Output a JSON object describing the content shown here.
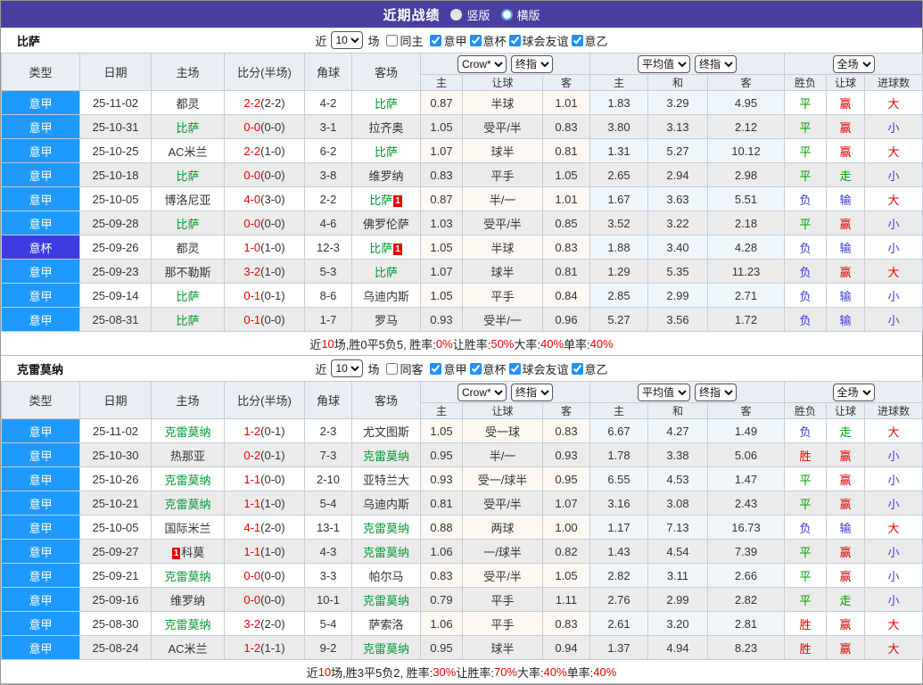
{
  "colors": {
    "title_bar_bg": "#4a3f9e",
    "league_serie_a_bg": "#1e9aff",
    "league_cup_bg": "#3c3ce0",
    "self_team_green": "#009933",
    "result_red": "#e60000",
    "result_green": "#009900",
    "result_blue": "#3a3ad6",
    "checkbox_blue": "#1e90ff"
  },
  "title_bar": {
    "title": "近期战绩",
    "vertical_label": "竖版",
    "horizontal_label": "横版"
  },
  "filter": {
    "near_label": "近",
    "count": "10",
    "games_label": "场",
    "leagues": [
      "意甲",
      "意杯",
      "球会友谊",
      "意乙"
    ]
  },
  "header": {
    "type": "类型",
    "date": "日期",
    "home": "主场",
    "score": "比分(半场)",
    "corner": "角球",
    "away": "客场",
    "crow_select": "Crow*",
    "final_select_1": "终指",
    "avg_select": "平均值",
    "final_select_2": "终指",
    "full_select": "全场",
    "sub": [
      "主",
      "让球",
      "客",
      "主",
      "和",
      "客",
      "胜负",
      "让球",
      "进球数"
    ]
  },
  "sections": [
    {
      "team": "比萨",
      "same_label": "同主",
      "rows": [
        {
          "type": "意甲",
          "tc": "a",
          "date": "25-11-02",
          "home": {
            "n": "都灵"
          },
          "ft": "2-2",
          "ht": "(2-2)",
          "corner": "4-2",
          "away": {
            "n": "比萨",
            "self": true
          },
          "odds": [
            "0.87",
            "半球",
            "1.01"
          ],
          "avg": [
            "1.83",
            "3.29",
            "4.95"
          ],
          "res": [
            [
              "平",
              "g"
            ],
            [
              "赢",
              "r"
            ],
            [
              "大",
              "r"
            ]
          ]
        },
        {
          "type": "意甲",
          "tc": "a",
          "date": "25-10-31",
          "home": {
            "n": "比萨",
            "self": true
          },
          "ft": "0-0",
          "ht": "(0-0)",
          "corner": "3-1",
          "away": {
            "n": "拉齐奥"
          },
          "odds": [
            "1.05",
            "受平/半",
            "0.83"
          ],
          "avg": [
            "3.80",
            "3.13",
            "2.12"
          ],
          "res": [
            [
              "平",
              "g"
            ],
            [
              "赢",
              "r"
            ],
            [
              "小",
              "b"
            ]
          ]
        },
        {
          "type": "意甲",
          "tc": "a",
          "date": "25-10-25",
          "home": {
            "n": "AC米兰"
          },
          "ft": "2-2",
          "ht": "(1-0)",
          "corner": "6-2",
          "away": {
            "n": "比萨",
            "self": true
          },
          "odds": [
            "1.07",
            "球半",
            "0.81"
          ],
          "avg": [
            "1.31",
            "5.27",
            "10.12"
          ],
          "res": [
            [
              "平",
              "g"
            ],
            [
              "赢",
              "r"
            ],
            [
              "大",
              "r"
            ]
          ]
        },
        {
          "type": "意甲",
          "tc": "a",
          "date": "25-10-18",
          "home": {
            "n": "比萨",
            "self": true
          },
          "ft": "0-0",
          "ht": "(0-0)",
          "corner": "3-8",
          "away": {
            "n": "维罗纳"
          },
          "odds": [
            "0.83",
            "平手",
            "1.05"
          ],
          "avg": [
            "2.65",
            "2.94",
            "2.98"
          ],
          "res": [
            [
              "平",
              "g"
            ],
            [
              "走",
              "g"
            ],
            [
              "小",
              "b"
            ]
          ]
        },
        {
          "type": "意甲",
          "tc": "a",
          "date": "25-10-05",
          "home": {
            "n": "博洛尼亚"
          },
          "ft": "4-0",
          "ht": "(3-0)",
          "corner": "2-2",
          "away": {
            "n": "比萨",
            "self": true,
            "card": "1",
            "cardPos": "r"
          },
          "odds": [
            "0.87",
            "半/一",
            "1.01"
          ],
          "avg": [
            "1.67",
            "3.63",
            "5.51"
          ],
          "res": [
            [
              "负",
              "b"
            ],
            [
              "输",
              "b"
            ],
            [
              "大",
              "r"
            ]
          ]
        },
        {
          "type": "意甲",
          "tc": "a",
          "date": "25-09-28",
          "home": {
            "n": "比萨",
            "self": true
          },
          "ft": "0-0",
          "ht": "(0-0)",
          "corner": "4-6",
          "away": {
            "n": "佛罗伦萨"
          },
          "odds": [
            "1.03",
            "受平/半",
            "0.85"
          ],
          "avg": [
            "3.52",
            "3.22",
            "2.18"
          ],
          "res": [
            [
              "平",
              "g"
            ],
            [
              "赢",
              "r"
            ],
            [
              "小",
              "b"
            ]
          ]
        },
        {
          "type": "意杯",
          "tc": "c",
          "date": "25-09-26",
          "home": {
            "n": "都灵"
          },
          "ft": "1-0",
          "ht": "(1-0)",
          "corner": "12-3",
          "away": {
            "n": "比萨",
            "self": true,
            "card": "1",
            "cardPos": "r"
          },
          "odds": [
            "1.05",
            "半球",
            "0.83"
          ],
          "avg": [
            "1.88",
            "3.40",
            "4.28"
          ],
          "res": [
            [
              "负",
              "b"
            ],
            [
              "输",
              "b"
            ],
            [
              "小",
              "b"
            ]
          ]
        },
        {
          "type": "意甲",
          "tc": "a",
          "date": "25-09-23",
          "home": {
            "n": "那不勒斯"
          },
          "ft": "3-2",
          "ht": "(1-0)",
          "corner": "5-3",
          "away": {
            "n": "比萨",
            "self": true
          },
          "odds": [
            "1.07",
            "球半",
            "0.81"
          ],
          "avg": [
            "1.29",
            "5.35",
            "11.23"
          ],
          "res": [
            [
              "负",
              "b"
            ],
            [
              "赢",
              "r"
            ],
            [
              "大",
              "r"
            ]
          ]
        },
        {
          "type": "意甲",
          "tc": "a",
          "date": "25-09-14",
          "home": {
            "n": "比萨",
            "self": true
          },
          "ft": "0-1",
          "ht": "(0-1)",
          "corner": "8-6",
          "away": {
            "n": "乌迪内斯"
          },
          "odds": [
            "1.05",
            "平手",
            "0.84"
          ],
          "avg": [
            "2.85",
            "2.99",
            "2.71"
          ],
          "res": [
            [
              "负",
              "b"
            ],
            [
              "输",
              "b"
            ],
            [
              "小",
              "b"
            ]
          ]
        },
        {
          "type": "意甲",
          "tc": "a",
          "date": "25-08-31",
          "home": {
            "n": "比萨",
            "self": true
          },
          "ft": "0-1",
          "ht": "(0-0)",
          "corner": "1-7",
          "away": {
            "n": "罗马"
          },
          "odds": [
            "0.93",
            "受半/一",
            "0.96"
          ],
          "avg": [
            "5.27",
            "3.56",
            "1.72"
          ],
          "res": [
            [
              "负",
              "b"
            ],
            [
              "输",
              "b"
            ],
            [
              "小",
              "b"
            ]
          ]
        }
      ],
      "summary": [
        [
          "近",
          0
        ],
        [
          "10",
          1
        ],
        [
          "场,胜0平5负5, 胜率:",
          0
        ],
        [
          "0%",
          1
        ],
        [
          " 让胜率:",
          0
        ],
        [
          "50%",
          1
        ],
        [
          " 大率:",
          0
        ],
        [
          "40%",
          1
        ],
        [
          " 单率:",
          0
        ],
        [
          "40%",
          1
        ]
      ]
    },
    {
      "team": "克雷莫纳",
      "same_label": "同客",
      "rows": [
        {
          "type": "意甲",
          "tc": "a",
          "date": "25-11-02",
          "home": {
            "n": "克雷莫纳",
            "self": true
          },
          "ft": "1-2",
          "ht": "(0-1)",
          "corner": "2-3",
          "away": {
            "n": "尤文图斯"
          },
          "odds": [
            "1.05",
            "受一球",
            "0.83"
          ],
          "avg": [
            "6.67",
            "4.27",
            "1.49"
          ],
          "res": [
            [
              "负",
              "b"
            ],
            [
              "走",
              "g"
            ],
            [
              "大",
              "r"
            ]
          ]
        },
        {
          "type": "意甲",
          "tc": "a",
          "date": "25-10-30",
          "home": {
            "n": "热那亚"
          },
          "ft": "0-2",
          "ht": "(0-1)",
          "corner": "7-3",
          "away": {
            "n": "克雷莫纳",
            "self": true
          },
          "odds": [
            "0.95",
            "半/一",
            "0.93"
          ],
          "avg": [
            "1.78",
            "3.38",
            "5.06"
          ],
          "res": [
            [
              "胜",
              "r"
            ],
            [
              "赢",
              "r"
            ],
            [
              "小",
              "b"
            ]
          ]
        },
        {
          "type": "意甲",
          "tc": "a",
          "date": "25-10-26",
          "home": {
            "n": "克雷莫纳",
            "self": true
          },
          "ft": "1-1",
          "ht": "(0-0)",
          "corner": "2-10",
          "away": {
            "n": "亚特兰大"
          },
          "odds": [
            "0.93",
            "受一/球半",
            "0.95"
          ],
          "avg": [
            "6.55",
            "4.53",
            "1.47"
          ],
          "res": [
            [
              "平",
              "g"
            ],
            [
              "赢",
              "r"
            ],
            [
              "小",
              "b"
            ]
          ]
        },
        {
          "type": "意甲",
          "tc": "a",
          "date": "25-10-21",
          "home": {
            "n": "克雷莫纳",
            "self": true
          },
          "ft": "1-1",
          "ht": "(1-0)",
          "corner": "5-4",
          "away": {
            "n": "乌迪内斯"
          },
          "odds": [
            "0.81",
            "受平/半",
            "1.07"
          ],
          "avg": [
            "3.16",
            "3.08",
            "2.43"
          ],
          "res": [
            [
              "平",
              "g"
            ],
            [
              "赢",
              "r"
            ],
            [
              "小",
              "b"
            ]
          ]
        },
        {
          "type": "意甲",
          "tc": "a",
          "date": "25-10-05",
          "home": {
            "n": "国际米兰"
          },
          "ft": "4-1",
          "ht": "(2-0)",
          "corner": "13-1",
          "away": {
            "n": "克雷莫纳",
            "self": true
          },
          "odds": [
            "0.88",
            "两球",
            "1.00"
          ],
          "avg": [
            "1.17",
            "7.13",
            "16.73"
          ],
          "res": [
            [
              "负",
              "b"
            ],
            [
              "输",
              "b"
            ],
            [
              "大",
              "r"
            ]
          ]
        },
        {
          "type": "意甲",
          "tc": "a",
          "date": "25-09-27",
          "home": {
            "n": "科莫",
            "card": "1",
            "cardPos": "l"
          },
          "ft": "1-1",
          "ht": "(1-0)",
          "corner": "4-3",
          "away": {
            "n": "克雷莫纳",
            "self": true
          },
          "odds": [
            "1.06",
            "一/球半",
            "0.82"
          ],
          "avg": [
            "1.43",
            "4.54",
            "7.39"
          ],
          "res": [
            [
              "平",
              "g"
            ],
            [
              "赢",
              "r"
            ],
            [
              "小",
              "b"
            ]
          ]
        },
        {
          "type": "意甲",
          "tc": "a",
          "date": "25-09-21",
          "home": {
            "n": "克雷莫纳",
            "self": true
          },
          "ft": "0-0",
          "ht": "(0-0)",
          "corner": "3-3",
          "away": {
            "n": "帕尔马"
          },
          "odds": [
            "0.83",
            "受平/半",
            "1.05"
          ],
          "avg": [
            "2.82",
            "3.11",
            "2.66"
          ],
          "res": [
            [
              "平",
              "g"
            ],
            [
              "赢",
              "r"
            ],
            [
              "小",
              "b"
            ]
          ]
        },
        {
          "type": "意甲",
          "tc": "a",
          "date": "25-09-16",
          "home": {
            "n": "维罗纳"
          },
          "ft": "0-0",
          "ht": "(0-0)",
          "corner": "10-1",
          "away": {
            "n": "克雷莫纳",
            "self": true
          },
          "odds": [
            "0.79",
            "平手",
            "1.11"
          ],
          "avg": [
            "2.76",
            "2.99",
            "2.82"
          ],
          "res": [
            [
              "平",
              "g"
            ],
            [
              "走",
              "g"
            ],
            [
              "小",
              "b"
            ]
          ]
        },
        {
          "type": "意甲",
          "tc": "a",
          "date": "25-08-30",
          "home": {
            "n": "克雷莫纳",
            "self": true
          },
          "ft": "3-2",
          "ht": "(2-0)",
          "corner": "5-4",
          "away": {
            "n": "萨索洛"
          },
          "odds": [
            "1.06",
            "平手",
            "0.83"
          ],
          "avg": [
            "2.61",
            "3.20",
            "2.81"
          ],
          "res": [
            [
              "胜",
              "r"
            ],
            [
              "赢",
              "r"
            ],
            [
              "大",
              "r"
            ]
          ]
        },
        {
          "type": "意甲",
          "tc": "a",
          "date": "25-08-24",
          "home": {
            "n": "AC米兰"
          },
          "ft": "1-2",
          "ht": "(1-1)",
          "corner": "9-2",
          "away": {
            "n": "克雷莫纳",
            "self": true
          },
          "odds": [
            "0.95",
            "球半",
            "0.94"
          ],
          "avg": [
            "1.37",
            "4.94",
            "8.23"
          ],
          "res": [
            [
              "胜",
              "r"
            ],
            [
              "赢",
              "r"
            ],
            [
              "大",
              "r"
            ]
          ]
        }
      ],
      "summary": [
        [
          "近",
          0
        ],
        [
          "10",
          1
        ],
        [
          "场,胜3平5负2, 胜率:",
          0
        ],
        [
          "30%",
          1
        ],
        [
          " 让胜率:",
          0
        ],
        [
          "70%",
          1
        ],
        [
          " 大率:",
          0
        ],
        [
          "40%",
          1
        ],
        [
          " 单率:",
          0
        ],
        [
          "40%",
          1
        ]
      ]
    }
  ]
}
